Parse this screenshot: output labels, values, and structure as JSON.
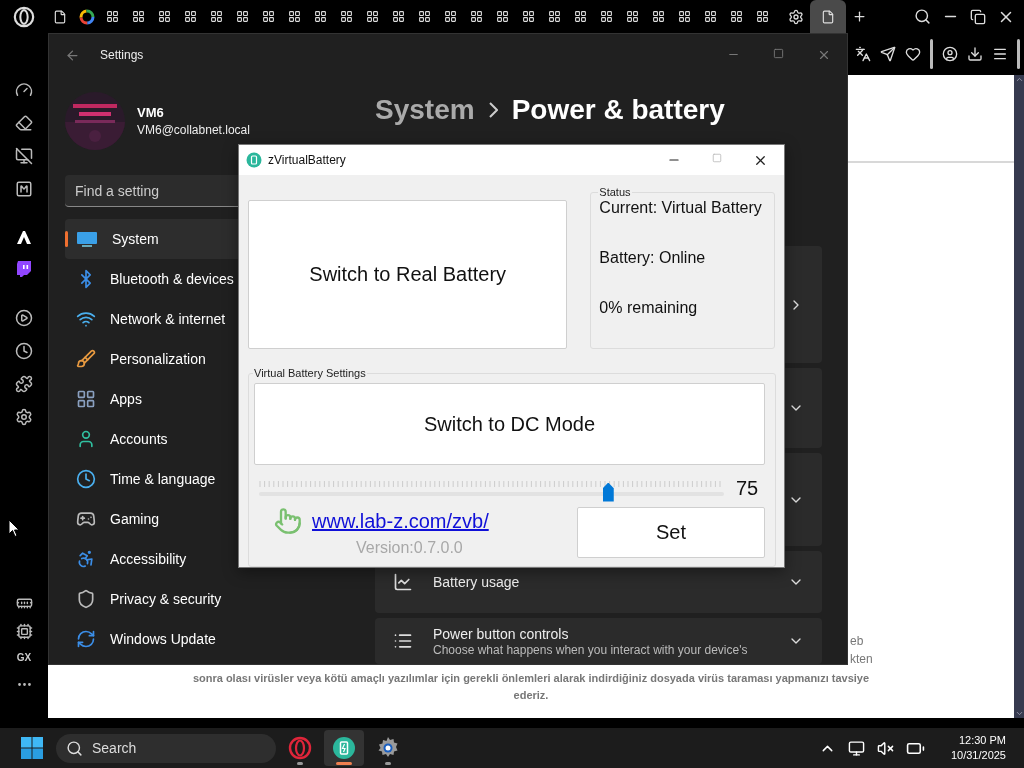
{
  "browser": {
    "sidebar_badge": "GX",
    "page": {
      "fragments": [
        "eb",
        "kten"
      ],
      "notice": "sonra olası virüsler veya kötü amaçlı yazılımlar için gerekli önlemleri alarak indirdiğiniz dosyada **virüs taraması yapmanızı tavsiye ederiz.**"
    }
  },
  "settings": {
    "title": "Settings",
    "user": {
      "name": "VM6",
      "email": "VM6@collabnet.local"
    },
    "search": {
      "placeholder": "Find a setting"
    },
    "nav": [
      {
        "label": "System",
        "selected": true
      },
      {
        "label": "Bluetooth & devices",
        "selected": false
      },
      {
        "label": "Network & internet",
        "selected": false
      },
      {
        "label": "Personalization",
        "selected": false
      },
      {
        "label": "Apps",
        "selected": false
      },
      {
        "label": "Accounts",
        "selected": false
      },
      {
        "label": "Time & language",
        "selected": false
      },
      {
        "label": "Gaming",
        "selected": false
      },
      {
        "label": "Accessibility",
        "selected": false
      },
      {
        "label": "Privacy & security",
        "selected": false
      },
      {
        "label": "Windows Update",
        "selected": false
      }
    ],
    "breadcrumb": [
      "System",
      "Power & battery"
    ],
    "cards": [
      {
        "kind": "link"
      },
      {
        "kind": "expand"
      },
      {
        "kind": "expand"
      },
      {
        "kind": "expand",
        "title": "Battery usage"
      },
      {
        "kind": "expand",
        "title": "Power button controls",
        "subtitle": "Choose what happens when you interact with your device's"
      }
    ]
  },
  "dialog": {
    "title": "zVirtualBattery",
    "primary_button": "Switch to Real Battery",
    "status": {
      "label": "Status",
      "lines": [
        "Current: Virtual Battery",
        "Battery: Online",
        "0% remaining"
      ]
    },
    "settings_group": {
      "label": "Virtual Battery Settings",
      "mode_button": "Switch to DC Mode",
      "slider": {
        "level": 0.75,
        "reading": "75"
      },
      "link": "www.lab-z.com/zvb/",
      "version": "Version:0.7.0.0",
      "set_button": "Set"
    }
  },
  "taskbar": {
    "search": {
      "placeholder": "Search"
    },
    "apps": [
      {
        "kind": "opera",
        "selected": false
      },
      {
        "kind": "battery",
        "selected": true
      },
      {
        "kind": "settings",
        "selected": false
      }
    ],
    "clock": {
      "time": "12:30 PM",
      "date": "10/31/2025"
    }
  }
}
